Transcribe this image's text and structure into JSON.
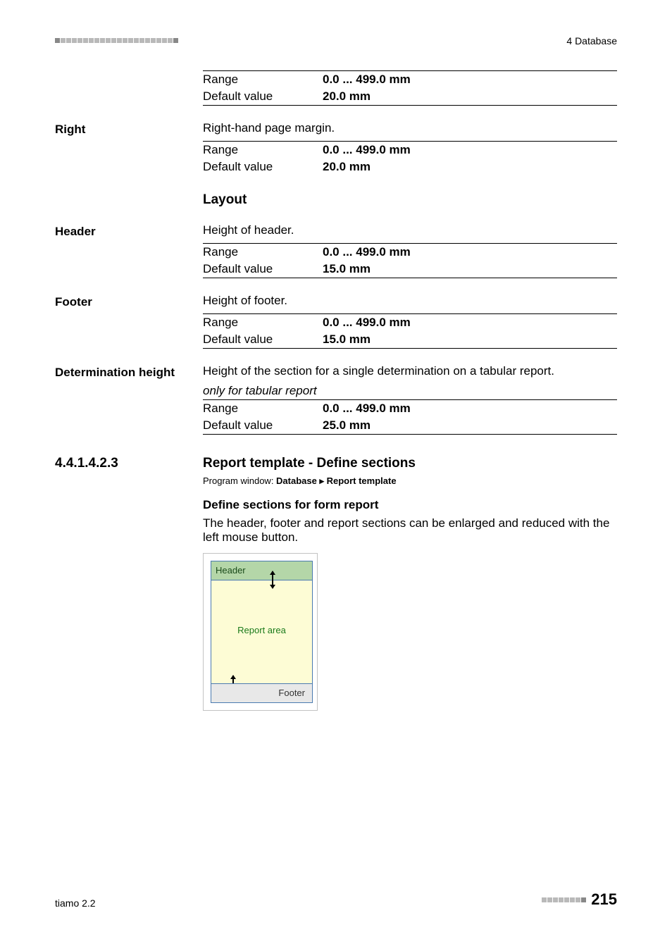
{
  "chapter": "4 Database",
  "params": {
    "top_range": {
      "k": "Range",
      "v": "0.0 ... 499.0 mm"
    },
    "top_default": {
      "k": "Default value",
      "v": "20.0 mm"
    },
    "right": {
      "label": "Right",
      "desc": "Right-hand page margin.",
      "range": {
        "k": "Range",
        "v": "0.0 ... 499.0 mm"
      },
      "def": {
        "k": "Default value",
        "v": "20.0 mm"
      }
    },
    "layout_heading": "Layout",
    "header": {
      "label": "Header",
      "desc": "Height of header.",
      "range": {
        "k": "Range",
        "v": "0.0 ... 499.0 mm"
      },
      "def": {
        "k": "Default value",
        "v": "15.0 mm"
      }
    },
    "footer": {
      "label": "Footer",
      "desc": "Height of footer.",
      "range": {
        "k": "Range",
        "v": "0.0 ... 499.0 mm"
      },
      "def": {
        "k": "Default value",
        "v": "15.0 mm"
      }
    },
    "det": {
      "label": "Determination height",
      "desc": "Height of the section for a single determination on a tabular report.",
      "note": "only for tabular report",
      "range": {
        "k": "Range",
        "v": "0.0 ... 499.0 mm"
      },
      "def": {
        "k": "Default value",
        "v": "25.0 mm"
      }
    }
  },
  "section": {
    "num": "4.4.1.4.2.3",
    "title": "Report template - Define sections",
    "prog_prefix": "Program window: ",
    "prog_path": "Database ▸ Report template",
    "sub_heading": "Define sections for form report",
    "sub_desc": "The header, footer and report sections can be enlarged and reduced with the left mouse button."
  },
  "diagram": {
    "header": "Header",
    "report": "Report area",
    "footer": "Footer"
  },
  "footer": {
    "product": "tiamo 2.2",
    "page": "215"
  }
}
